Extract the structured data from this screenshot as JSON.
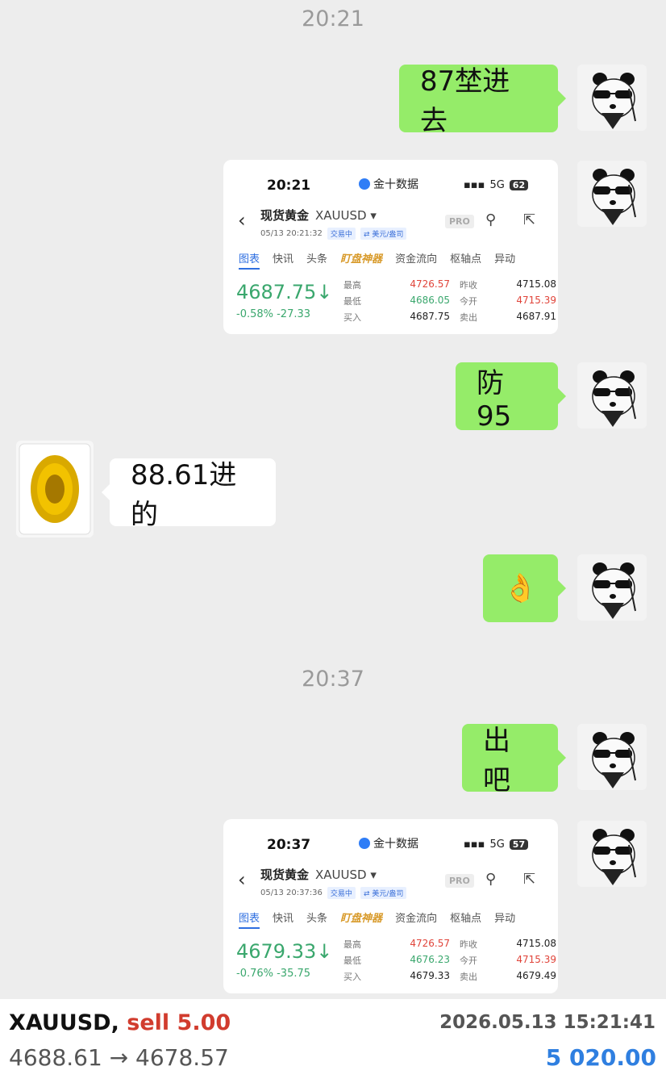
{
  "chat": {
    "time_1": "20:21",
    "time_2": "20:37",
    "messages": [
      {
        "text": "87埜进去"
      },
      {
        "text": "防95"
      },
      {
        "text": "88.61进的"
      },
      {
        "text": "👌"
      },
      {
        "text": "出吧"
      }
    ]
  },
  "cards": [
    {
      "status_time": "20:21",
      "app_name": "金十数据",
      "network": "5G",
      "battery": "62",
      "title": "现货黄金",
      "symbol": "XAUUSD ▾",
      "datetime": "05/13 20:21:32",
      "tag_trading": "交易中",
      "tag_currency": "⇄ 美元/盎司",
      "pro": "PRO",
      "tabs": [
        "图表",
        "快讯",
        "头条",
        "盯盘神器",
        "资金流向",
        "枢轴点",
        "异动"
      ],
      "price": "4687.75↓",
      "change": "-0.58%  -27.33",
      "stats": {
        "high_label": "最高",
        "high": "4726.57",
        "prev_close_label": "昨收",
        "prev_close": "4715.08",
        "low_label": "最低",
        "low": "4686.05",
        "open_label": "今开",
        "open": "4715.39",
        "buy_label": "买入",
        "buy": "4687.75",
        "sell_label": "卖出",
        "sell": "4687.91"
      }
    },
    {
      "status_time": "20:37",
      "app_name": "金十数据",
      "network": "5G",
      "battery": "57",
      "title": "现货黄金",
      "symbol": "XAUUSD ▾",
      "datetime": "05/13 20:37:36",
      "tag_trading": "交易中",
      "tag_currency": "⇄ 美元/盎司",
      "pro": "PRO",
      "tabs": [
        "图表",
        "快讯",
        "头条",
        "盯盘神器",
        "资金流向",
        "枢轴点",
        "异动"
      ],
      "price": "4679.33↓",
      "change": "-0.76%  -35.75",
      "stats": {
        "high_label": "最高",
        "high": "4726.57",
        "prev_close_label": "昨收",
        "prev_close": "4715.08",
        "low_label": "最低",
        "low": "4676.23",
        "open_label": "今开",
        "open": "4715.39",
        "buy_label": "买入",
        "buy": "4679.33",
        "sell_label": "卖出",
        "sell": "4679.49"
      }
    }
  ],
  "trade": {
    "symbol": "XAUUSD,",
    "side": "sell 5.00",
    "datetime": "2026.05.13 15:21:41",
    "prices": "4688.61 → 4678.57",
    "profit": "5 020.00"
  }
}
